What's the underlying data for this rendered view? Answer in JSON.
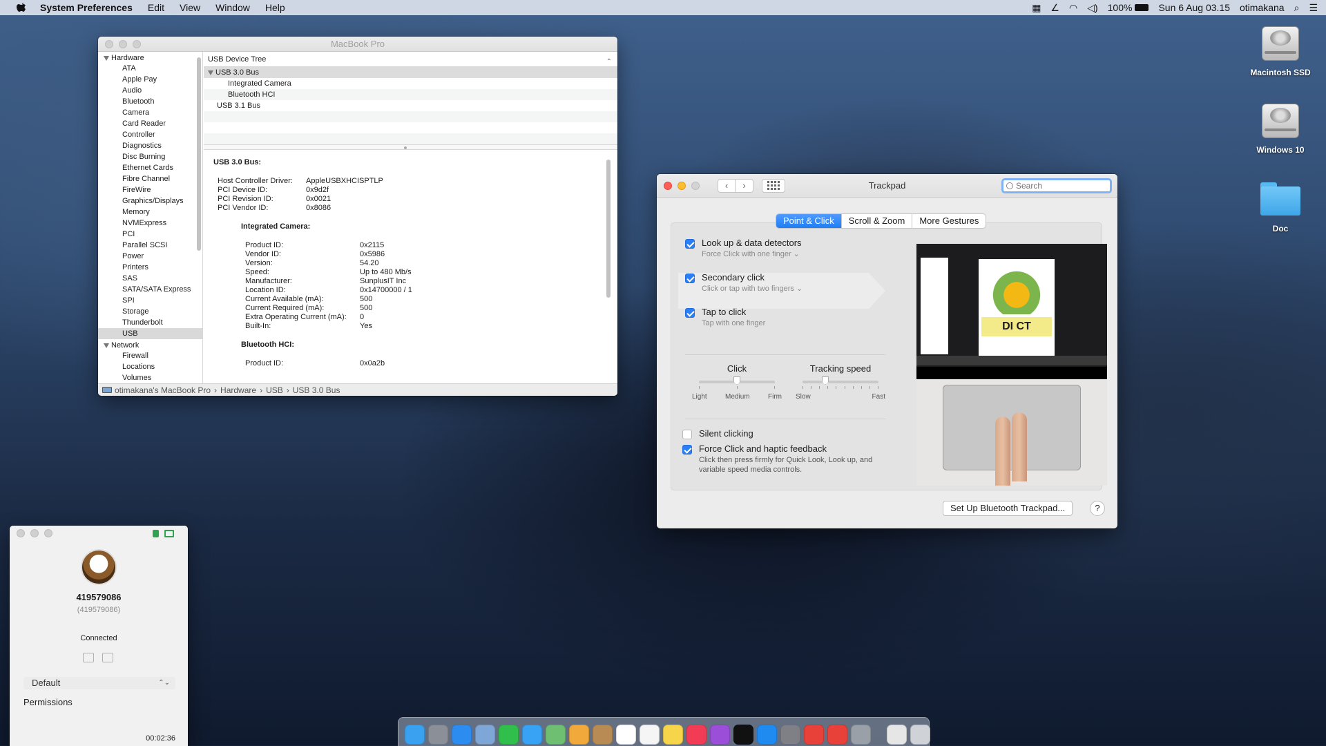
{
  "menubar": {
    "app": "System Preferences",
    "menus": [
      "Edit",
      "View",
      "Window",
      "Help"
    ],
    "battery": "100%",
    "datetime": "Sun 6 Aug  03.15",
    "user": "otimakana"
  },
  "desktop": {
    "icons": [
      "Macintosh SSD",
      "Windows 10",
      "Doc"
    ]
  },
  "sysinfo": {
    "title": "MacBook Pro",
    "sidebar": {
      "hardware_label": "Hardware",
      "hardware_items": [
        "ATA",
        "Apple Pay",
        "Audio",
        "Bluetooth",
        "Camera",
        "Card Reader",
        "Controller",
        "Diagnostics",
        "Disc Burning",
        "Ethernet Cards",
        "Fibre Channel",
        "FireWire",
        "Graphics/Displays",
        "Memory",
        "NVMExpress",
        "PCI",
        "Parallel SCSI",
        "Power",
        "Printers",
        "SAS",
        "SATA/SATA Express",
        "SPI",
        "Storage",
        "Thunderbolt",
        "USB"
      ],
      "network_label": "Network",
      "network_items": [
        "Firewall",
        "Locations",
        "Volumes"
      ]
    },
    "tree": {
      "header": "USB Device Tree",
      "rows": [
        "USB 3.0 Bus",
        "Integrated Camera",
        "Bluetooth HCI",
        "USB 3.1 Bus"
      ]
    },
    "detail": {
      "heading": "USB 3.0 Bus:",
      "bus": [
        [
          "Host Controller Driver:",
          "AppleUSBXHCISPTLP"
        ],
        [
          "PCI Device ID:",
          "0x9d2f"
        ],
        [
          "PCI Revision ID:",
          "0x0021"
        ],
        [
          "PCI Vendor ID:",
          "0x8086"
        ]
      ],
      "camera_heading": "Integrated Camera:",
      "camera": [
        [
          "Product ID:",
          "0x2115"
        ],
        [
          "Vendor ID:",
          "0x5986"
        ],
        [
          "Version:",
          "54.20"
        ],
        [
          "Speed:",
          "Up to 480 Mb/s"
        ],
        [
          "Manufacturer:",
          "SunplusIT Inc"
        ],
        [
          "Location ID:",
          "0x14700000 / 1"
        ],
        [
          "Current Available (mA):",
          "500"
        ],
        [
          "Current Required (mA):",
          "500"
        ],
        [
          "Extra Operating Current (mA):",
          "0"
        ],
        [
          "Built-In:",
          "Yes"
        ]
      ],
      "bt_heading": "Bluetooth HCI:",
      "bt": [
        [
          "Product ID:",
          "0x0a2b"
        ]
      ]
    },
    "path": [
      "otimakana's MacBook Pro",
      "Hardware",
      "USB",
      "USB 3.0 Bus"
    ]
  },
  "trackpad": {
    "title": "Trackpad",
    "search_placeholder": "Search",
    "tabs": [
      "Point & Click",
      "Scroll & Zoom",
      "More Gestures"
    ],
    "options": [
      {
        "label": "Look up & data detectors",
        "desc": "Force Click with one finger ⌄",
        "checked": true
      },
      {
        "label": "Secondary click",
        "desc": "Click or tap with two fingers ⌄",
        "checked": true
      },
      {
        "label": "Tap to click",
        "desc": "Tap with one finger",
        "checked": true
      }
    ],
    "click": {
      "title": "Click",
      "labels": [
        "Light",
        "Medium",
        "Firm"
      ],
      "value": 0.5
    },
    "tracking": {
      "title": "Tracking speed",
      "labels": [
        "Slow",
        "Fast"
      ],
      "value": 0.3
    },
    "silent": {
      "label": "Silent clicking",
      "checked": false
    },
    "force": {
      "label": "Force Click and haptic feedback",
      "desc": "Click then press firmly for Quick Look, Look up, and variable speed media controls.",
      "checked": true
    },
    "preview_text": "DI CT",
    "setup_button": "Set Up Bluetooth Trackpad...",
    "help": "?"
  },
  "remote": {
    "id": "419579086",
    "id_sub": "(419579086)",
    "status": "Connected",
    "profile": "Default",
    "permissions": "Permissions",
    "timer": "00:02:36"
  },
  "dock": {
    "apps": [
      {
        "name": "finder-icon",
        "color": "#3aa0f0",
        "run": true
      },
      {
        "name": "launchpad-icon",
        "color": "#8a8f98",
        "run": false
      },
      {
        "name": "safari-icon",
        "color": "#2d8cf0",
        "run": true
      },
      {
        "name": "preview-icon",
        "color": "#7ea7d8",
        "run": false
      },
      {
        "name": "facetime-icon",
        "color": "#2fbf4a",
        "run": false
      },
      {
        "name": "messages-icon",
        "color": "#38a2f5",
        "run": false
      },
      {
        "name": "maps-icon",
        "color": "#6fbf73",
        "run": false
      },
      {
        "name": "photos-icon",
        "color": "#f2a93b",
        "run": false
      },
      {
        "name": "contacts-icon",
        "color": "#b98b54",
        "run": false
      },
      {
        "name": "calendar-icon",
        "color": "#ffffff",
        "run": false
      },
      {
        "name": "reminders-icon",
        "color": "#f5f5f5",
        "run": false
      },
      {
        "name": "notes-icon",
        "color": "#f6d54a",
        "run": false
      },
      {
        "name": "music-icon",
        "color": "#f23c55",
        "run": false
      },
      {
        "name": "podcasts-icon",
        "color": "#9b4ed8",
        "run": false
      },
      {
        "name": "tv-icon",
        "color": "#111111",
        "run": false
      },
      {
        "name": "appstore-icon",
        "color": "#1f8bf0",
        "run": false
      },
      {
        "name": "system-preferences-icon",
        "color": "#7f7f86",
        "run": true
      },
      {
        "name": "anydesk-icon",
        "color": "#e8413a",
        "run": true
      },
      {
        "name": "anydesk2-icon",
        "color": "#e8413a",
        "run": true
      },
      {
        "name": "system-info-icon",
        "color": "#9aa0a8",
        "run": true
      }
    ],
    "right": [
      {
        "name": "documents-stack-icon",
        "color": "#e6e6e6"
      },
      {
        "name": "trash-icon",
        "color": "#cfd3d8"
      }
    ]
  }
}
